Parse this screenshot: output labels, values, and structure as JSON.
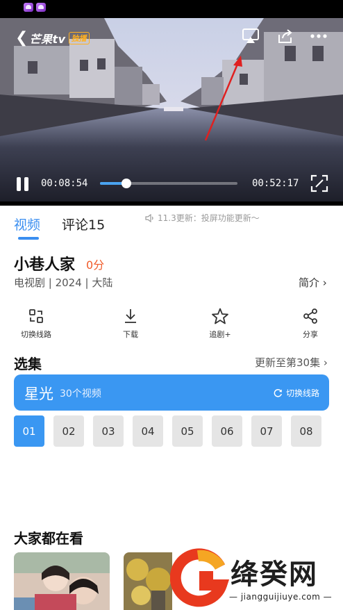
{
  "player": {
    "logo": {
      "brand": "芒果tv",
      "tag": "独播"
    },
    "current_time": "00:08:54",
    "total_time": "00:52:17",
    "progress_fraction": 0.19
  },
  "tabs": [
    {
      "label": "视频",
      "active": true
    },
    {
      "label": "评论15",
      "active": false
    }
  ],
  "update_note": "11.3更新：投屏功能更新～",
  "show": {
    "title": "小巷人家",
    "score": "0分",
    "meta": "电视剧 | 2024 | 大陆",
    "intro_label": "简介"
  },
  "actions": [
    {
      "label": "切换线路",
      "icon": "route-switch-icon"
    },
    {
      "label": "下载",
      "icon": "download-icon"
    },
    {
      "label": "追剧+",
      "icon": "star-icon"
    },
    {
      "label": "分享",
      "icon": "share-icon"
    }
  ],
  "episodes_section": {
    "title": "选集",
    "update_to": "更新至第30集",
    "source": {
      "name": "星光",
      "count": "30个视频",
      "switch_label": "切换线路"
    },
    "items": [
      "01",
      "02",
      "03",
      "04",
      "05",
      "06",
      "07",
      "08"
    ],
    "selected": "01"
  },
  "watching_section": {
    "title": "大家都在看"
  },
  "watermark": {
    "text": "绛癸网",
    "url": "jiangguijiuye.com"
  },
  "colors": {
    "accent": "#3a97f2",
    "score": "#f05a28",
    "annotation_arrow": "#e02020"
  }
}
